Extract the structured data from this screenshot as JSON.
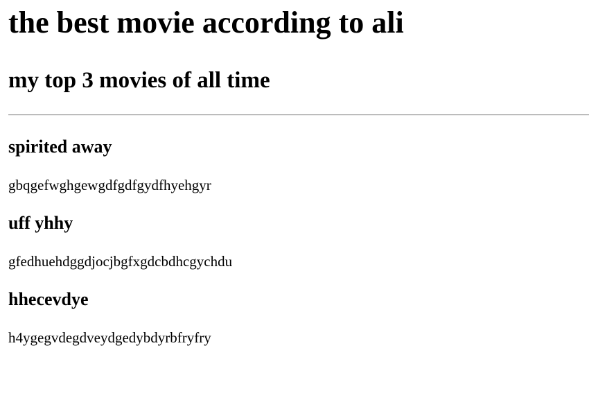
{
  "page": {
    "title": "the best movie according to ali",
    "subtitle": "my top 3 movies of all time"
  },
  "movies": [
    {
      "title": "spirited away",
      "description": "gbqgefwghgewgdfgdfgydfhyehgyr"
    },
    {
      "title": "uff yhhy",
      "description": "gfedhuehdggdjocjbgfxgdcbdhcgychdu"
    },
    {
      "title": "hhecevdye",
      "description": "h4ygegvdegdveydgedybdyrbfryfry"
    }
  ]
}
